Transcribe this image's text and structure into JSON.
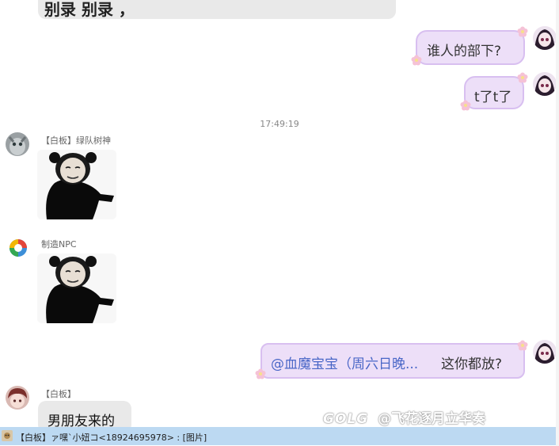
{
  "messages": {
    "top_partial_text": "别录 别录 ，",
    "out1_text": "谁人的部下?",
    "out2_text": "t了t了",
    "timestamp": "17:49:19",
    "sender1_name": "【白板】绿队树神",
    "sender2_name": "制造NPC",
    "out3_mention": "@血魔宝宝（周六日晚...",
    "out3_text": "这你都放?",
    "sender3_name": "【白板】",
    "in3_text": "男朋友来的"
  },
  "bottom_bar": {
    "notification": "【白板】ァ嘿`小妞コ<18924695978>  :  [图片]"
  },
  "watermark": {
    "brand": "GOLG",
    "text": "@飞花逐月立华奏"
  },
  "colors": {
    "bubble_out_bg": "#eddff8",
    "bubble_out_border": "#d8bff0",
    "bubble_in_bg": "#e9e9e9",
    "mention_color": "#4a67c7",
    "bottom_bar_bg": "#bcd9f2"
  }
}
